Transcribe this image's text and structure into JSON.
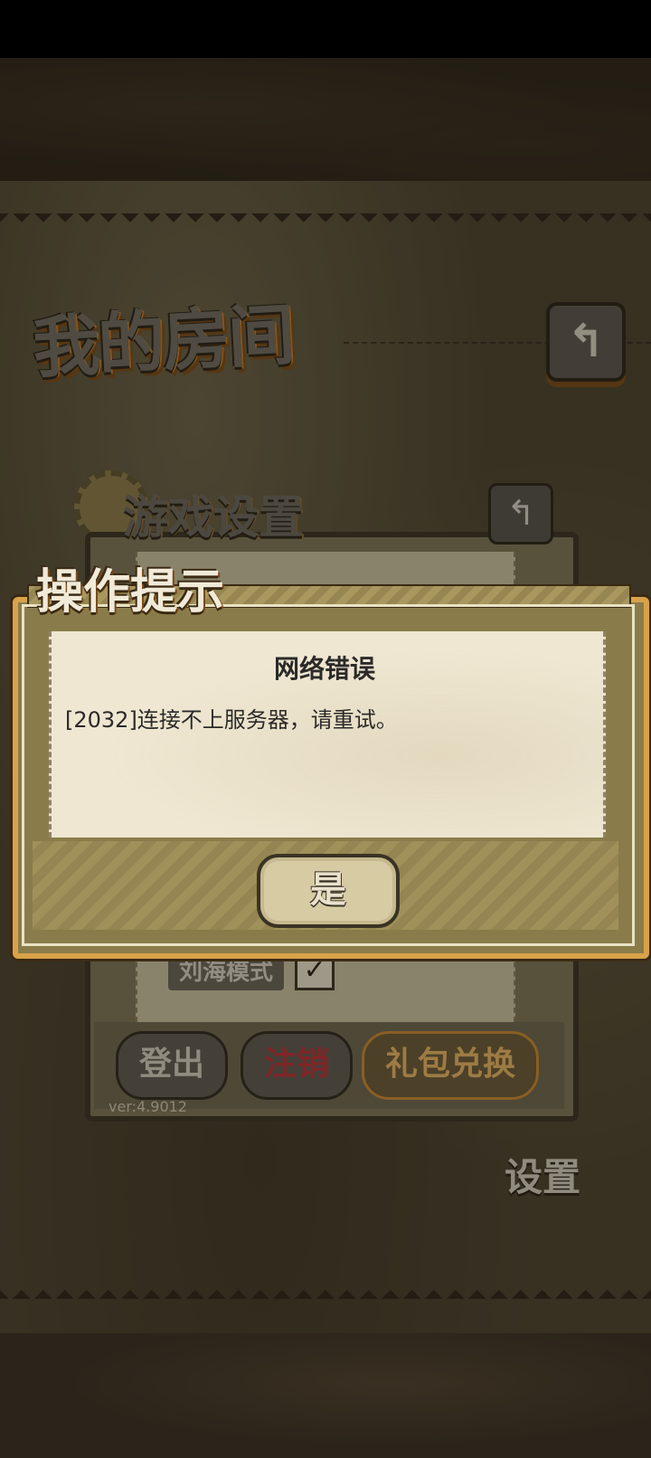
{
  "room": {
    "title": "我的房间",
    "back_icon": "back-arrow-icon"
  },
  "settings_panel": {
    "title": "游戏设置",
    "notch_mode_label": "刘海模式",
    "notch_mode_checked": "✓",
    "logout_label": "登出",
    "cancel_account_label": "注销",
    "gift_redeem_label": "礼包兑换",
    "version": "ver:4.9012",
    "settings_tab_label": "设置"
  },
  "dialog": {
    "title": "操作提示",
    "error_title": "网络错误",
    "error_message": "[2032]连接不上服务器，请重试。",
    "confirm_label": "是"
  },
  "colors": {
    "accent": "#d9a24a",
    "danger": "#b8323a",
    "gift": "#e6b464"
  }
}
